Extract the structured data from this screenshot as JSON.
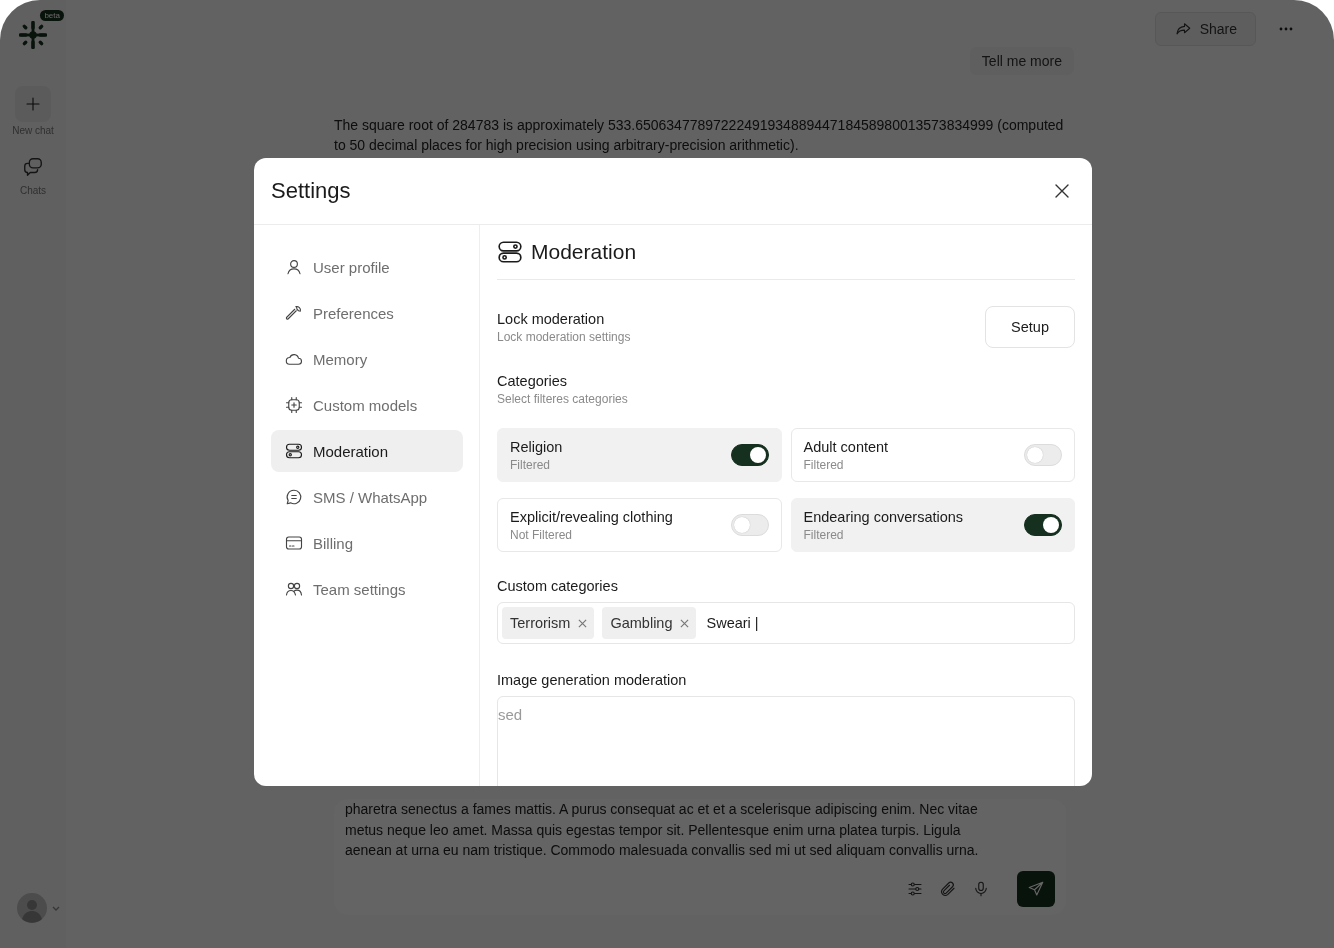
{
  "app": {
    "logo_badge": "beta",
    "rail": [
      {
        "kind": "new",
        "label": "New chat"
      },
      {
        "kind": "chats",
        "label": "Chats"
      }
    ]
  },
  "header": {
    "share": "Share"
  },
  "chat": {
    "user_message": "Tell me more",
    "reply": "The square root of 284783 is approximately 533.6506347789722249193488944718458980013573834999 (computed to 50 decimal places for high precision using arbitrary-precision arithmetic).",
    "composer_lines": [
      "pharetra senectus a fames mattis. A purus consequat ac et et a scelerisque adipiscing enim. Nec vitae",
      "metus neque leo amet. Massa quis egestas tempor sit. Pellentesque enim urna platea turpis. Ligula",
      "aenean at urna eu nam tristique. Commodo malesuada convallis sed mi ut sed aliquam convallis urna."
    ]
  },
  "settings": {
    "title": "Settings",
    "nav": [
      {
        "kind": "user",
        "label": "User profile",
        "selected": false
      },
      {
        "kind": "wrench",
        "label": "Preferences",
        "selected": false
      },
      {
        "kind": "cloud",
        "label": "Memory",
        "selected": false
      },
      {
        "kind": "chip",
        "label": "Custom models",
        "selected": false
      },
      {
        "kind": "toggles",
        "label": "Moderation",
        "selected": true
      },
      {
        "kind": "chat",
        "label": "SMS / WhatsApp",
        "selected": false
      },
      {
        "kind": "card",
        "label": "Billing",
        "selected": false
      },
      {
        "kind": "users",
        "label": "Team settings",
        "selected": false
      }
    ],
    "section": {
      "title": "Moderation",
      "lock": {
        "title": "Lock moderation",
        "subtitle": "Lock moderation settings",
        "button": "Setup"
      },
      "categories": {
        "title": "Categories",
        "subtitle": "Select filteres categories",
        "items": [
          {
            "name": "Religion",
            "status": "Filtered",
            "on": true
          },
          {
            "name": "Adult content",
            "status": "Filtered",
            "on": false
          },
          {
            "name": "Explicit/revealing clothing",
            "status": "Not Filtered",
            "on": false
          },
          {
            "name": "Endearing conversations",
            "status": "Filtered",
            "on": true
          }
        ]
      },
      "custom": {
        "label": "Custom categories",
        "tags": [
          "Terrorism",
          "Gambling"
        ],
        "value": "Sweari |"
      },
      "image": {
        "label": "Image generation moderation",
        "value": "sed"
      }
    }
  }
}
